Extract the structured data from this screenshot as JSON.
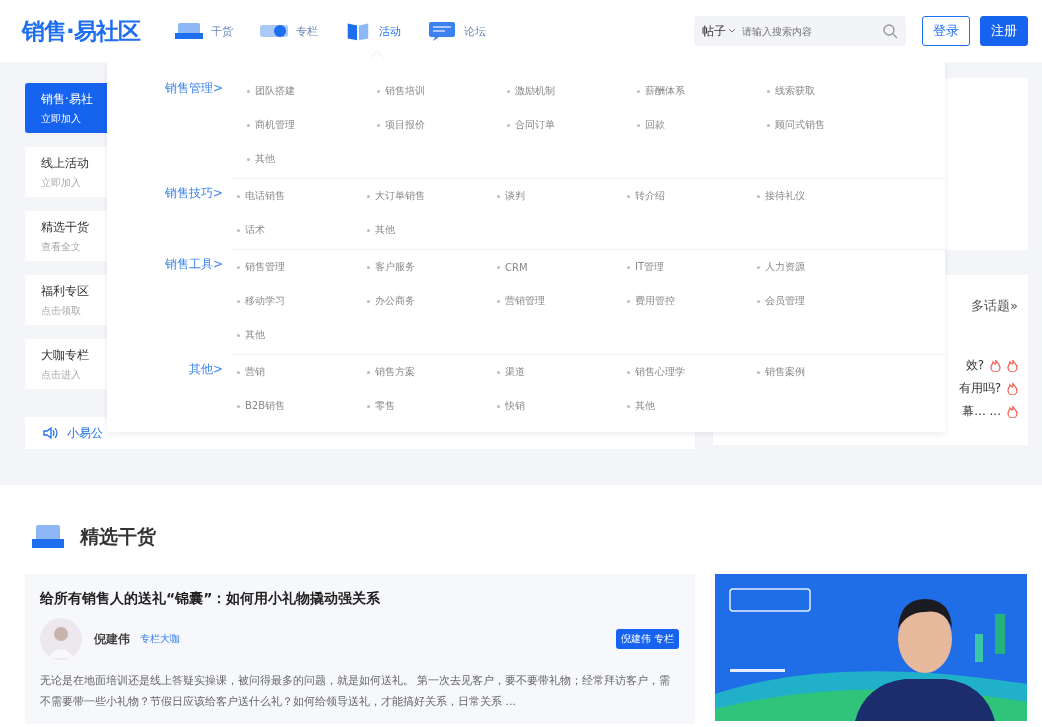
{
  "header": {
    "logo": "销售·易社区",
    "nav": [
      {
        "label": "干货",
        "selected": false
      },
      {
        "label": "专栏",
        "selected": false
      },
      {
        "label": "活动",
        "selected": true
      },
      {
        "label": "论坛",
        "selected": false
      }
    ],
    "search": {
      "scope": "帖子",
      "placeholder": "请输入搜索内容"
    },
    "login": "登录",
    "register": "注册"
  },
  "sidebar": [
    {
      "title": "销售·易社",
      "subtitle": "立即加入",
      "selected": true
    },
    {
      "title": "线上活动",
      "subtitle": "立即加入",
      "selected": false
    },
    {
      "title": "精选干货",
      "subtitle": "查看全文",
      "selected": false
    },
    {
      "title": "福利专区",
      "subtitle": "点击领取",
      "selected": false
    },
    {
      "title": "大咖专栏",
      "subtitle": "点击进入",
      "selected": false
    }
  ],
  "notice": {
    "label": "小易公"
  },
  "topics": {
    "more": "多话题»",
    "lines": [
      {
        "text": "效?",
        "marks": [
          {
            "kind": "flame"
          },
          {
            "kind": "flame"
          }
        ]
      },
      {
        "text": "有用吗?",
        "marks": [
          {
            "kind": "flame"
          }
        ]
      },
      {
        "text": "幕... ...",
        "marks": [
          {
            "kind": "flame"
          }
        ]
      }
    ]
  },
  "menu": [
    {
      "category": "销售管理>",
      "items": [
        "团队搭建",
        "销售培训",
        "激励机制",
        "薪酬体系",
        "线索获取",
        "商机管理",
        "项目报价",
        "合同订单",
        "回款",
        "顾问式销售",
        "其他"
      ]
    },
    {
      "category": "销售技巧>",
      "items": [
        "电话销售",
        "大订单销售",
        "谈判",
        "转介绍",
        "接待礼仪",
        "话术",
        "其他"
      ]
    },
    {
      "category": "销售工具>",
      "items": [
        "销售管理",
        "客户服务",
        "CRM",
        "IT管理",
        "人力资源",
        "移动学习",
        "办公商务",
        "营销管理",
        "费用管控",
        "会员管理",
        "其他"
      ]
    },
    {
      "category": "其他>",
      "items": [
        "营销",
        "销售方案",
        "渠道",
        "销售心理学",
        "销售案例",
        "B2B销售",
        "零售",
        "快销",
        "其他"
      ]
    }
  ],
  "section": {
    "title": "精选干货"
  },
  "article": {
    "title": "给所有销售人的送礼“锦囊”：如何用小礼物撬动强关系",
    "author": "倪建伟",
    "role": "专栏大咖",
    "badge": "倪建伟 专栏",
    "excerpt": "无论是在地面培训还是线上答疑实操课，被问得最多的问题，就是如何送礼。 第一次去见客户，要不要带礼物；经常拜访客户，需不需要带一些小礼物？节假日应该给客户送什么礼？如何给领导送礼，才能搞好关系，日常关系 ..."
  }
}
